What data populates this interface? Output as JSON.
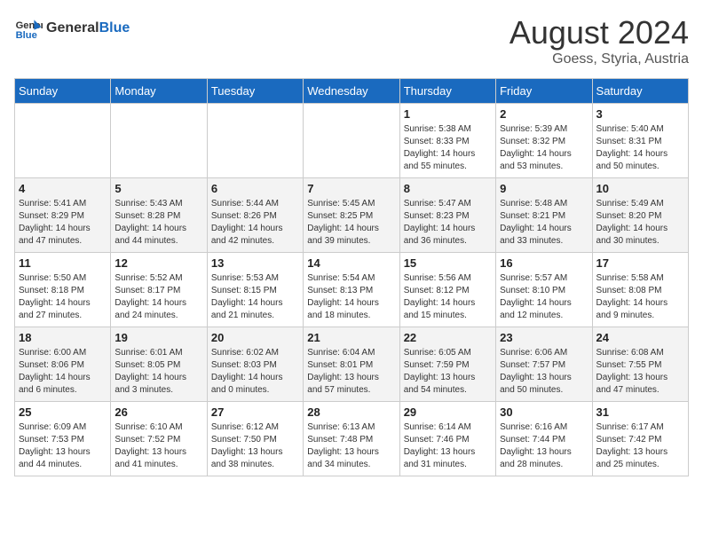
{
  "logo": {
    "general": "General",
    "blue": "Blue"
  },
  "title": {
    "month_year": "August 2024",
    "location": "Goess, Styria, Austria"
  },
  "days_of_week": [
    "Sunday",
    "Monday",
    "Tuesday",
    "Wednesday",
    "Thursday",
    "Friday",
    "Saturday"
  ],
  "weeks": [
    [
      {
        "day": "",
        "sunrise": "",
        "sunset": "",
        "daylight": ""
      },
      {
        "day": "",
        "sunrise": "",
        "sunset": "",
        "daylight": ""
      },
      {
        "day": "",
        "sunrise": "",
        "sunset": "",
        "daylight": ""
      },
      {
        "day": "",
        "sunrise": "",
        "sunset": "",
        "daylight": ""
      },
      {
        "day": "1",
        "sunrise": "Sunrise: 5:38 AM",
        "sunset": "Sunset: 8:33 PM",
        "daylight": "Daylight: 14 hours and 55 minutes."
      },
      {
        "day": "2",
        "sunrise": "Sunrise: 5:39 AM",
        "sunset": "Sunset: 8:32 PM",
        "daylight": "Daylight: 14 hours and 53 minutes."
      },
      {
        "day": "3",
        "sunrise": "Sunrise: 5:40 AM",
        "sunset": "Sunset: 8:31 PM",
        "daylight": "Daylight: 14 hours and 50 minutes."
      }
    ],
    [
      {
        "day": "4",
        "sunrise": "Sunrise: 5:41 AM",
        "sunset": "Sunset: 8:29 PM",
        "daylight": "Daylight: 14 hours and 47 minutes."
      },
      {
        "day": "5",
        "sunrise": "Sunrise: 5:43 AM",
        "sunset": "Sunset: 8:28 PM",
        "daylight": "Daylight: 14 hours and 44 minutes."
      },
      {
        "day": "6",
        "sunrise": "Sunrise: 5:44 AM",
        "sunset": "Sunset: 8:26 PM",
        "daylight": "Daylight: 14 hours and 42 minutes."
      },
      {
        "day": "7",
        "sunrise": "Sunrise: 5:45 AM",
        "sunset": "Sunset: 8:25 PM",
        "daylight": "Daylight: 14 hours and 39 minutes."
      },
      {
        "day": "8",
        "sunrise": "Sunrise: 5:47 AM",
        "sunset": "Sunset: 8:23 PM",
        "daylight": "Daylight: 14 hours and 36 minutes."
      },
      {
        "day": "9",
        "sunrise": "Sunrise: 5:48 AM",
        "sunset": "Sunset: 8:21 PM",
        "daylight": "Daylight: 14 hours and 33 minutes."
      },
      {
        "day": "10",
        "sunrise": "Sunrise: 5:49 AM",
        "sunset": "Sunset: 8:20 PM",
        "daylight": "Daylight: 14 hours and 30 minutes."
      }
    ],
    [
      {
        "day": "11",
        "sunrise": "Sunrise: 5:50 AM",
        "sunset": "Sunset: 8:18 PM",
        "daylight": "Daylight: 14 hours and 27 minutes."
      },
      {
        "day": "12",
        "sunrise": "Sunrise: 5:52 AM",
        "sunset": "Sunset: 8:17 PM",
        "daylight": "Daylight: 14 hours and 24 minutes."
      },
      {
        "day": "13",
        "sunrise": "Sunrise: 5:53 AM",
        "sunset": "Sunset: 8:15 PM",
        "daylight": "Daylight: 14 hours and 21 minutes."
      },
      {
        "day": "14",
        "sunrise": "Sunrise: 5:54 AM",
        "sunset": "Sunset: 8:13 PM",
        "daylight": "Daylight: 14 hours and 18 minutes."
      },
      {
        "day": "15",
        "sunrise": "Sunrise: 5:56 AM",
        "sunset": "Sunset: 8:12 PM",
        "daylight": "Daylight: 14 hours and 15 minutes."
      },
      {
        "day": "16",
        "sunrise": "Sunrise: 5:57 AM",
        "sunset": "Sunset: 8:10 PM",
        "daylight": "Daylight: 14 hours and 12 minutes."
      },
      {
        "day": "17",
        "sunrise": "Sunrise: 5:58 AM",
        "sunset": "Sunset: 8:08 PM",
        "daylight": "Daylight: 14 hours and 9 minutes."
      }
    ],
    [
      {
        "day": "18",
        "sunrise": "Sunrise: 6:00 AM",
        "sunset": "Sunset: 8:06 PM",
        "daylight": "Daylight: 14 hours and 6 minutes."
      },
      {
        "day": "19",
        "sunrise": "Sunrise: 6:01 AM",
        "sunset": "Sunset: 8:05 PM",
        "daylight": "Daylight: 14 hours and 3 minutes."
      },
      {
        "day": "20",
        "sunrise": "Sunrise: 6:02 AM",
        "sunset": "Sunset: 8:03 PM",
        "daylight": "Daylight: 14 hours and 0 minutes."
      },
      {
        "day": "21",
        "sunrise": "Sunrise: 6:04 AM",
        "sunset": "Sunset: 8:01 PM",
        "daylight": "Daylight: 13 hours and 57 minutes."
      },
      {
        "day": "22",
        "sunrise": "Sunrise: 6:05 AM",
        "sunset": "Sunset: 7:59 PM",
        "daylight": "Daylight: 13 hours and 54 minutes."
      },
      {
        "day": "23",
        "sunrise": "Sunrise: 6:06 AM",
        "sunset": "Sunset: 7:57 PM",
        "daylight": "Daylight: 13 hours and 50 minutes."
      },
      {
        "day": "24",
        "sunrise": "Sunrise: 6:08 AM",
        "sunset": "Sunset: 7:55 PM",
        "daylight": "Daylight: 13 hours and 47 minutes."
      }
    ],
    [
      {
        "day": "25",
        "sunrise": "Sunrise: 6:09 AM",
        "sunset": "Sunset: 7:53 PM",
        "daylight": "Daylight: 13 hours and 44 minutes."
      },
      {
        "day": "26",
        "sunrise": "Sunrise: 6:10 AM",
        "sunset": "Sunset: 7:52 PM",
        "daylight": "Daylight: 13 hours and 41 minutes."
      },
      {
        "day": "27",
        "sunrise": "Sunrise: 6:12 AM",
        "sunset": "Sunset: 7:50 PM",
        "daylight": "Daylight: 13 hours and 38 minutes."
      },
      {
        "day": "28",
        "sunrise": "Sunrise: 6:13 AM",
        "sunset": "Sunset: 7:48 PM",
        "daylight": "Daylight: 13 hours and 34 minutes."
      },
      {
        "day": "29",
        "sunrise": "Sunrise: 6:14 AM",
        "sunset": "Sunset: 7:46 PM",
        "daylight": "Daylight: 13 hours and 31 minutes."
      },
      {
        "day": "30",
        "sunrise": "Sunrise: 6:16 AM",
        "sunset": "Sunset: 7:44 PM",
        "daylight": "Daylight: 13 hours and 28 minutes."
      },
      {
        "day": "31",
        "sunrise": "Sunrise: 6:17 AM",
        "sunset": "Sunset: 7:42 PM",
        "daylight": "Daylight: 13 hours and 25 minutes."
      }
    ]
  ]
}
